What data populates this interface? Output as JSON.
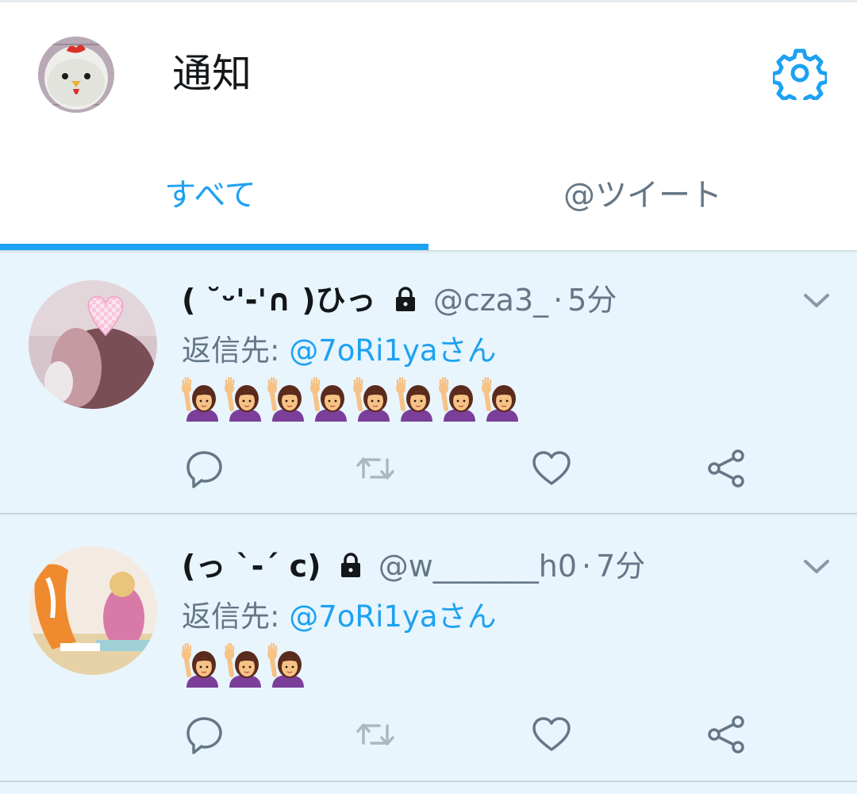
{
  "header": {
    "title": "通知",
    "settings_icon": "gear-icon",
    "accent_color": "#1da1f2"
  },
  "tabs": [
    {
      "label": "すべて",
      "selected": true
    },
    {
      "label": "@ツイート",
      "selected": false
    }
  ],
  "tweets": [
    {
      "display_name": "( ˘ᵕ'-'∩ )ひっ",
      "protected": true,
      "handle": "@cza3_",
      "separator": "·",
      "time": "5分",
      "reply_label": "返信先:",
      "reply_target": "@7oRi1yaさん",
      "emoji": "raising-hand-woman",
      "emoji_count": 8
    },
    {
      "display_name": "(っ ˋ-ˊ c)",
      "protected": true,
      "handle": "@w_______h0",
      "separator": "·",
      "time": "7分",
      "reply_label": "返信先:",
      "reply_target": "@7oRi1yaさん",
      "emoji": "raising-hand-woman",
      "emoji_count": 3
    }
  ],
  "actions": [
    "reply-icon",
    "retweet-icon",
    "like-icon",
    "share-icon"
  ]
}
